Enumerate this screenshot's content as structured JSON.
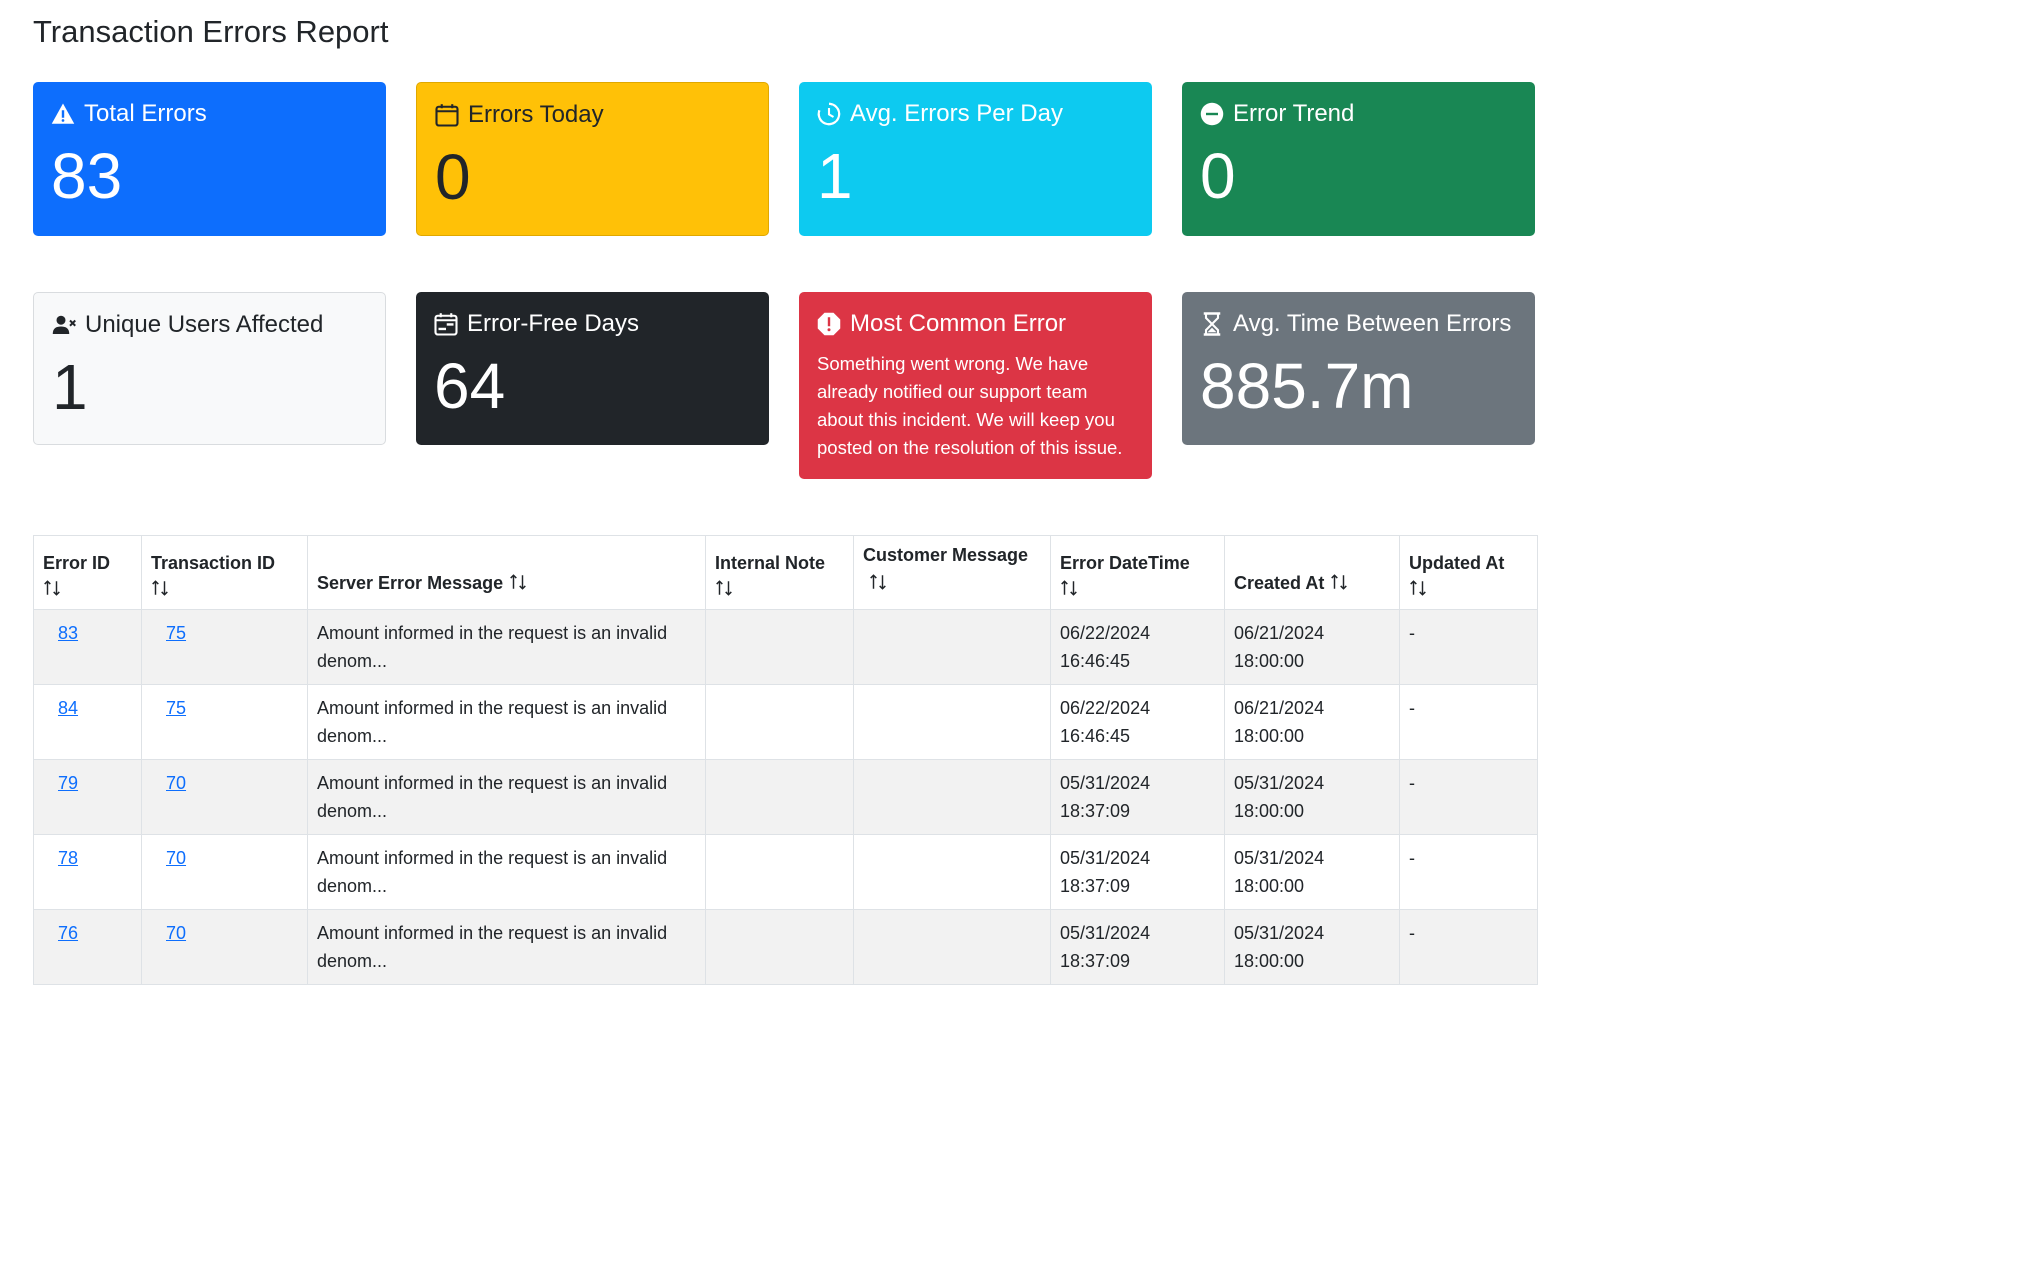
{
  "page": {
    "title": "Transaction Errors Report"
  },
  "cards": {
    "total_errors": {
      "label": "Total Errors",
      "value": "83",
      "icon": "warning-triangle-icon"
    },
    "errors_today": {
      "label": "Errors Today",
      "value": "0",
      "icon": "calendar-icon"
    },
    "avg_per_day": {
      "label": "Avg. Errors Per Day",
      "value": "1",
      "icon": "clock-history-icon"
    },
    "error_trend": {
      "label": "Error Trend",
      "value": "0",
      "icon": "dash-circle-icon"
    },
    "unique_users": {
      "label": "Unique Users Affected",
      "value": "1",
      "icon": "person-x-icon"
    },
    "error_free_days": {
      "label": "Error-Free Days",
      "value": "64",
      "icon": "calendar-range-icon"
    },
    "most_common": {
      "label": "Most Common Error",
      "message": "Something went wrong. We have already notified our support team about this incident. We will keep you posted on the resolution of this issue.",
      "icon": "exclamation-octagon-icon"
    },
    "avg_time_between": {
      "label": "Avg. Time Between Errors",
      "value": "885.7m",
      "icon": "hourglass-icon"
    }
  },
  "table": {
    "columns": [
      "Error ID",
      "Transaction ID",
      "Server Error Message",
      "Internal Note",
      "Customer Message",
      "Error DateTime",
      "Created At",
      "Updated At"
    ],
    "rows": [
      {
        "error_id": "83",
        "transaction_id": "75",
        "server_message": "Amount informed in the request is an invalid denom...",
        "internal_note": "",
        "customer_message": "",
        "error_datetime": "06/22/2024 16:46:45",
        "created_at": "06/21/2024 18:00:00",
        "updated_at": "-"
      },
      {
        "error_id": "84",
        "transaction_id": "75",
        "server_message": "Amount informed in the request is an invalid denom...",
        "internal_note": "",
        "customer_message": "",
        "error_datetime": "06/22/2024 16:46:45",
        "created_at": "06/21/2024 18:00:00",
        "updated_at": "-"
      },
      {
        "error_id": "79",
        "transaction_id": "70",
        "server_message": "Amount informed in the request is an invalid denom...",
        "internal_note": "",
        "customer_message": "",
        "error_datetime": "05/31/2024 18:37:09",
        "created_at": "05/31/2024 18:00:00",
        "updated_at": "-"
      },
      {
        "error_id": "78",
        "transaction_id": "70",
        "server_message": "Amount informed in the request is an invalid denom...",
        "internal_note": "",
        "customer_message": "",
        "error_datetime": "05/31/2024 18:37:09",
        "created_at": "05/31/2024 18:00:00",
        "updated_at": "-"
      },
      {
        "error_id": "76",
        "transaction_id": "70",
        "server_message": "Amount informed in the request is an invalid denom...",
        "internal_note": "",
        "customer_message": "",
        "error_datetime": "05/31/2024 18:37:09",
        "created_at": "05/31/2024 18:00:00",
        "updated_at": "-"
      }
    ]
  },
  "colors": {
    "primary": "#0d6efd",
    "warning": "#ffc107",
    "info": "#0dcaf0",
    "success": "#198754",
    "light": "#f8f9fa",
    "dark": "#212529",
    "danger": "#dc3545",
    "secondary": "#6c757d"
  }
}
